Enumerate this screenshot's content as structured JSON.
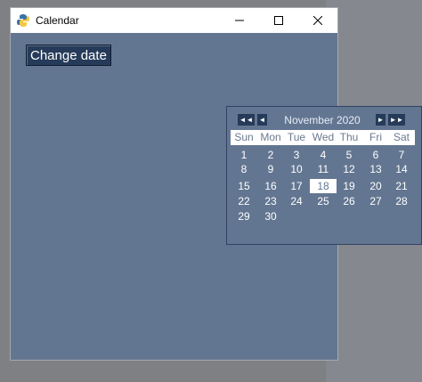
{
  "window": {
    "title": "Calendar"
  },
  "main": {
    "change_date_label": "Change date"
  },
  "calendar": {
    "month_label": "November 2020",
    "prev_year_label": "◄◄",
    "prev_month_label": "◄",
    "next_month_label": "►",
    "next_year_label": "►►",
    "weekdays": [
      "Sun",
      "Mon",
      "Tue",
      "Wed",
      "Thu",
      "Fri",
      "Sat"
    ],
    "weeks": [
      [
        "1",
        "2",
        "3",
        "4",
        "5",
        "6",
        "7"
      ],
      [
        "8",
        "9",
        "10",
        "11",
        "12",
        "13",
        "14"
      ],
      [
        "15",
        "16",
        "17",
        "18",
        "19",
        "20",
        "21"
      ],
      [
        "22",
        "23",
        "24",
        "25",
        "26",
        "27",
        "28"
      ],
      [
        "29",
        "30",
        "",
        "",
        "",
        "",
        ""
      ]
    ],
    "selected_day": "18"
  },
  "colors": {
    "bg": "#637691",
    "button": "#263b59",
    "selected": "#ffffff"
  }
}
